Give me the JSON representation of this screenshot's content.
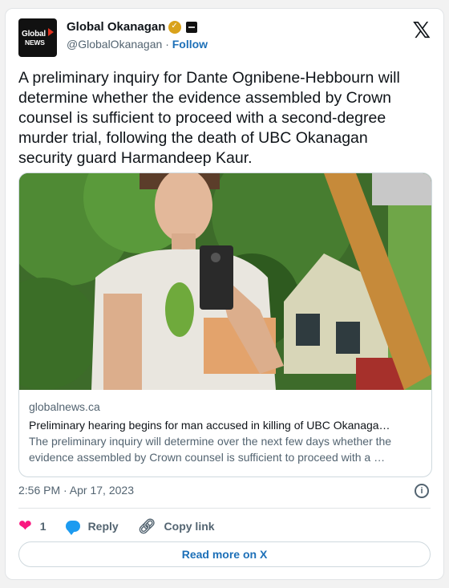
{
  "account": {
    "avatar_text_line1": "Global",
    "avatar_text_line2": "NEWS",
    "name": "Global Okanagan",
    "handle": "@GlobalOkanagan",
    "separator": "·",
    "follow_label": "Follow"
  },
  "tweet": {
    "text": "A preliminary inquiry for Dante Ognibene-Hebbourn will determine whether the evidence assembled by Crown counsel is sufficient to proceed with a second-degree murder trial, following the death of UBC Okanagan security guard Harmandeep Kaur.",
    "timestamp": "2:56 PM · Apr 17, 2023"
  },
  "link_card": {
    "domain": "globalnews.ca",
    "title": "Preliminary hearing begins for man accused in killing of UBC Okanaga…",
    "description": "The preliminary inquiry will determine over the next few days whether the evidence assembled by Crown counsel is sufficient to proceed with a …"
  },
  "actions": {
    "like_count": "1",
    "reply_label": "Reply",
    "copy_label": "Copy link",
    "read_more_label": "Read more on X"
  },
  "icons": {
    "verified": "gold-verified-badge-icon",
    "affiliate": "affiliate-badge-icon",
    "x_logo": "x-logo-icon",
    "info": "info-icon",
    "like": "heart-icon",
    "reply": "reply-bubble-icon",
    "copy": "link-icon"
  },
  "colors": {
    "like": "#f91880",
    "reply": "#1d9bf0",
    "link": "#1d70b8",
    "badge": "#d9a21b"
  }
}
